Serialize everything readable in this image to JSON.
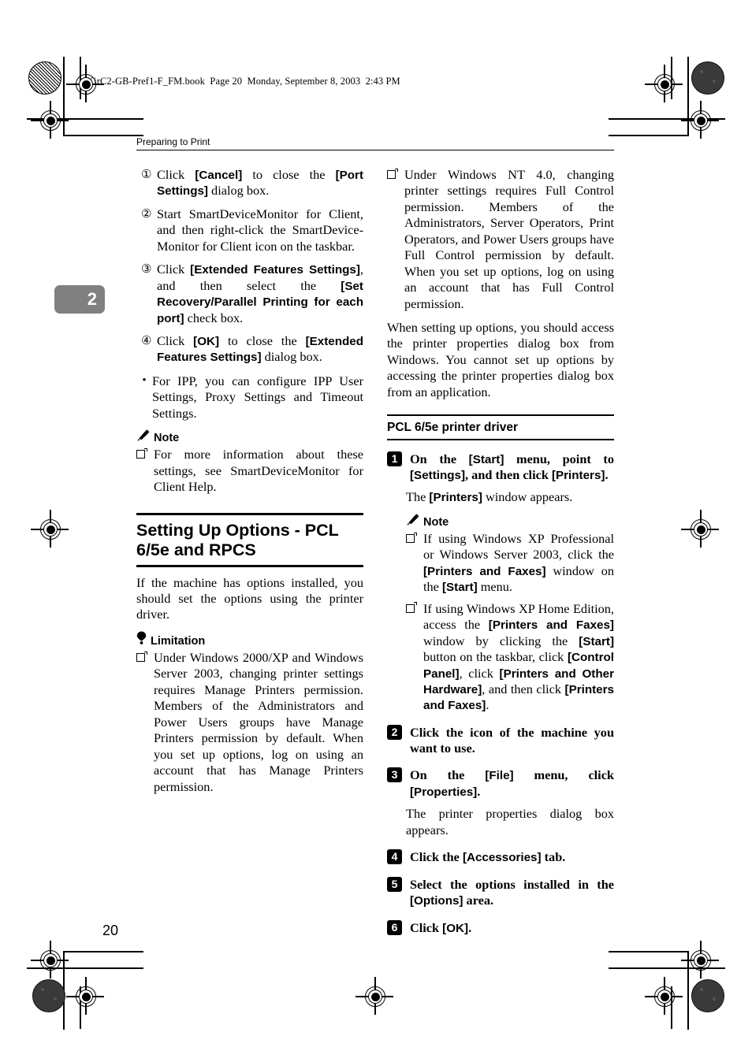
{
  "book_header": "KirC2-GB-Pref1-F_FM.book  Page 20  Monday, September 8, 2003  2:43 PM",
  "running_head": "Preparing to Print",
  "chapter_tab": "2",
  "page_number": "20",
  "colors": {
    "chapter_tab_bg": "#808080",
    "text": "#000000",
    "page_bg": "#ffffff"
  },
  "left_column": {
    "numbered_items": [
      {
        "num": "①",
        "text_html": "Click <b>[Cancel]</b> to close the <b>[Port Settings]</b> dialog box."
      },
      {
        "num": "②",
        "text_html": "Start SmartDeviceMonitor for Client, and then right-click the SmartDevice-Monitor for Client icon on the taskbar."
      },
      {
        "num": "③",
        "text_html": "Click <b>[Extended Features Settings]</b>, and then select the <b>[Set Recovery/Parallel Printing for each port]</b> check box."
      },
      {
        "num": "④",
        "text_html": "Click <b>[OK]</b> to close the <b>[Extended Features Settings]</b> dialog box."
      }
    ],
    "bullet_item": "For IPP, you can configure IPP User Settings, Proxy Settings and Timeout Settings.",
    "note_label": "Note",
    "note_items": [
      "For more information about these settings, see SmartDeviceMonitor for Client Help."
    ],
    "section_heading": "Setting Up Options - PCL 6/5e and RPCS",
    "section_intro": "If the machine has options installed, you should set the options using the printer driver.",
    "limitation_label": "Limitation",
    "limitation_items": [
      "Under Windows 2000/XP and Windows Server 2003, changing printer settings requires Manage Printers permission. Members of the Administrators and Power Users groups have Manage Printers permission by default. When you set up options, log on using an account that has Manage Printers permission."
    ]
  },
  "right_column": {
    "limitation_items": [
      "Under Windows NT 4.0, changing printer settings requires Full Control permission. Members of the Administrators, Server Operators, Print Operators, and Power Users groups have Full Control permission by default. When you set up options, log on using an account that has Full Control permission."
    ],
    "paragraph": "When setting up options, you should access the printer properties dialog box from Windows. You cannot set up options by accessing the printer properties dialog box from an application.",
    "sub_heading": "PCL 6/5e printer driver",
    "steps": [
      {
        "num": "1",
        "text_html": "On the <b>[Start]</b> menu, point to <b>[Settings]</b>, and then click <b>[Printers]</b>."
      },
      {
        "num": "2",
        "text_html": "Click the icon of the machine you want to use."
      },
      {
        "num": "3",
        "text_html": "On the <b>[File]</b> menu, click <b>[Properties]</b>."
      },
      {
        "num": "4",
        "text_html": "Click the <b>[Accessories]</b> tab."
      },
      {
        "num": "5",
        "text_html": "Select the options installed in the <b>[Options]</b> area."
      },
      {
        "num": "6",
        "text_html": "Click <b>[OK]</b>."
      }
    ],
    "step1_follow_html": "The <b>[Printers]</b> window appears.",
    "step3_follow": "The printer properties dialog box appears.",
    "note_label": "Note",
    "note_items_html": [
      "If using Windows XP Professional or Windows Server 2003, click the <b>[Printers and Faxes]</b> window on the <b>[Start]</b> menu.",
      "If using Windows XP Home Edition, access the <b>[Printers and Faxes]</b> window by clicking the <b>[Start]</b> button on the taskbar, click <b>[Control Panel]</b>, click <b>[Printers and Other Hardware]</b>, and then click <b>[Printers and Faxes]</b>."
    ]
  },
  "icons": {
    "note": "pencil-icon",
    "limitation": "balloon-icon",
    "bullet_square": "square-bullet-icon",
    "registration": "registration-target-icon"
  }
}
